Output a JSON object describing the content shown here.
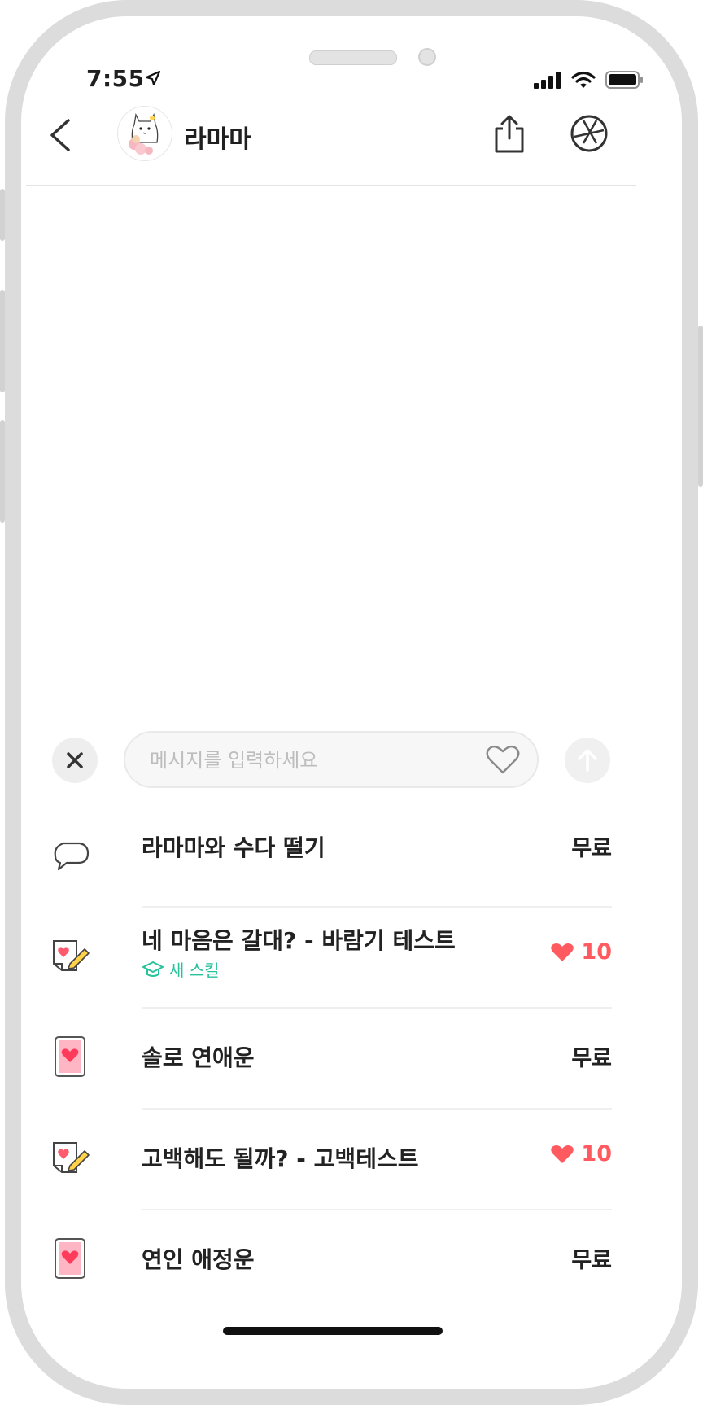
{
  "status_bar": {
    "time": "7:55"
  },
  "header": {
    "title": "라마마"
  },
  "composer": {
    "placeholder": "메시지를 입력하세요"
  },
  "menu": [
    {
      "label": "라마마와 수다 떨기",
      "price": "무료",
      "icon": "speech-bubble-icon"
    },
    {
      "label": "네 마음은 갈대? - 바람기 테스트",
      "sub": "새 스킬",
      "price": "10",
      "icon": "test-paper-icon"
    },
    {
      "label": "솔로 연애운",
      "price": "무료",
      "icon": "heart-card-icon"
    },
    {
      "label": "고백해도 될까? - 고백테스트",
      "price": "10",
      "icon": "test-paper-icon"
    },
    {
      "label": "연인 애정운",
      "price": "무료",
      "icon": "heart-card-icon"
    }
  ],
  "colors": {
    "accent_red": "#ff5a5f",
    "accent_green": "#27c29a"
  }
}
